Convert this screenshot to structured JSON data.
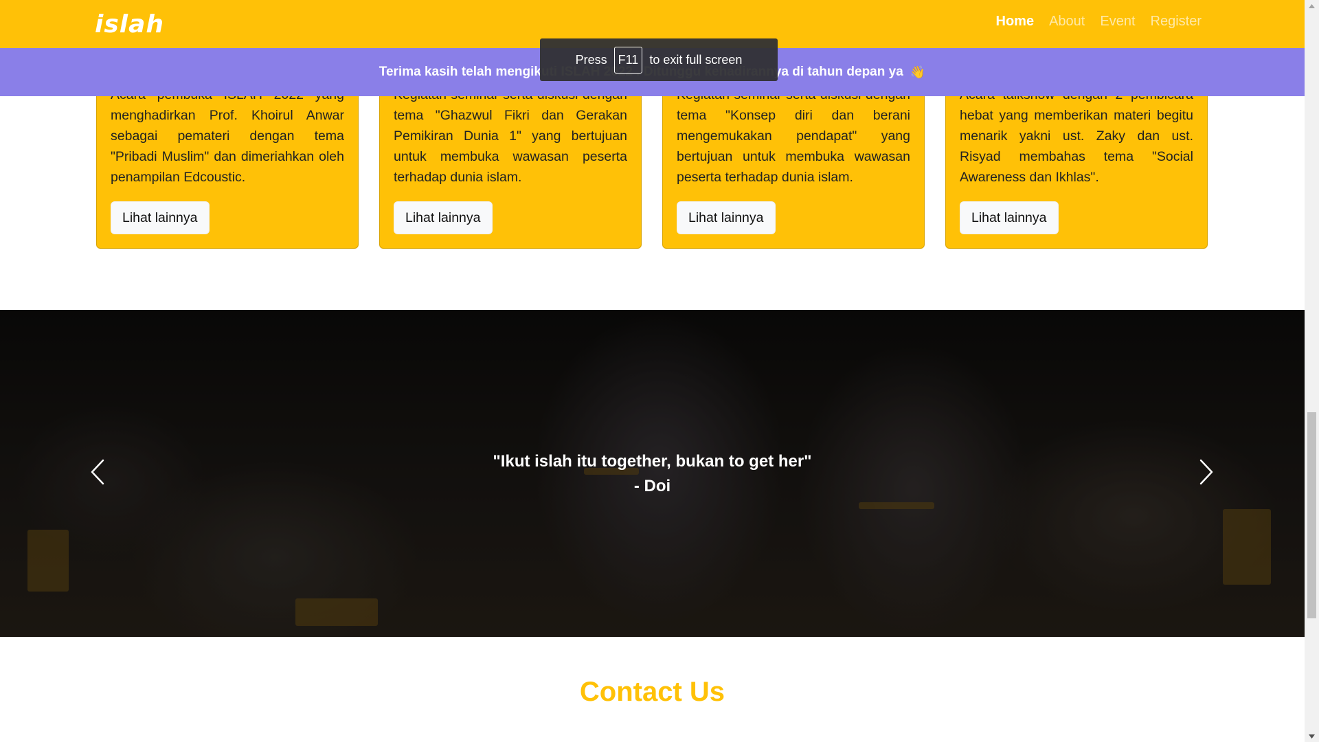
{
  "navbar": {
    "logo": "islah",
    "links": [
      {
        "label": "Home",
        "active": true
      },
      {
        "label": "About",
        "active": false
      },
      {
        "label": "Event",
        "active": false
      },
      {
        "label": "Register",
        "active": false
      }
    ]
  },
  "announcement": {
    "text": "Terima kasih telah mengikuti ISLAH 2022 . Ditunggu kehadirannya di tahun depan ya",
    "emoji": "👋"
  },
  "fullscreen_toast": {
    "prefix": "Press",
    "key": "F11",
    "suffix": "to exit full screen"
  },
  "cards": [
    {
      "body": "Acara pembuka ISLAH 2022 yang menghadirkan Prof. Khoirul Anwar sebagai pemateri dengan tema \"Pribadi Muslim\" dan dimeriahkan oleh penampilan Edcoustic.",
      "button": "Lihat lainnya"
    },
    {
      "body": "Kegiatan seminar serta diskusi dengan tema \"Ghazwul Fikri dan Gerakan Pemikiran Dunia 1\" yang bertujuan untuk membuka wawasan peserta terhadap dunia islam.",
      "button": "Lihat lainnya"
    },
    {
      "body": "Kegiatan seminar serta diskusi dengan tema \"Konsep diri dan berani mengemukakan pendapat\" yang bertujuan untuk membuka wawasan peserta terhadap dunia islam.",
      "button": "Lihat lainnya"
    },
    {
      "body": "Acara talkshow dengan 2 pembicara hebat yang memberikan materi begitu menarik yakni ust. Zaky dan ust. Risyad membahas tema \"Social Awareness dan Ikhlas\".",
      "button": "Lihat lainnya"
    }
  ],
  "carousel": {
    "quote": "\"Ikut islah itu together, bukan to get her\"",
    "author": "- Doi",
    "prev_icon": "chevron-left-icon",
    "next_icon": "chevron-right-icon"
  },
  "contact": {
    "title": "Contact Us"
  },
  "colors": {
    "primary": "#ffc107",
    "announcement": "#8a7fe8",
    "white": "#ffffff"
  }
}
